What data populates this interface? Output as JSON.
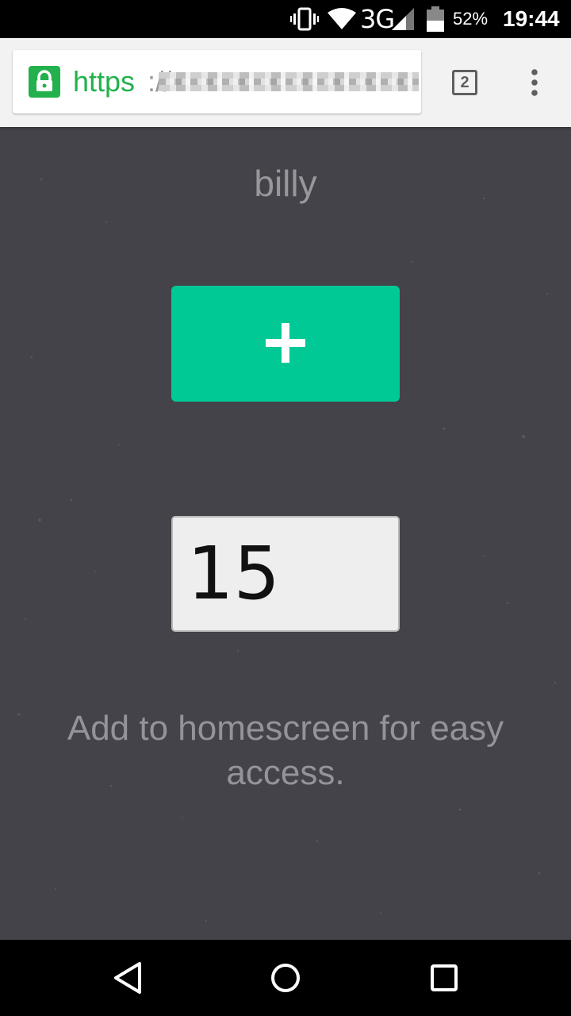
{
  "status_bar": {
    "network_type": "3G",
    "battery_percent": "52%",
    "time": "19:44",
    "icons": [
      "vibrate-icon",
      "wifi-icon",
      "cell-signal-icon",
      "battery-icon"
    ]
  },
  "browser": {
    "url_scheme": "https",
    "url_separator": "://",
    "tab_count": "2",
    "icons": [
      "lock-icon",
      "menu-icon"
    ]
  },
  "page": {
    "user_name": "billy",
    "add_button_icon": "plus-icon",
    "count_value": "15",
    "hint": "Add to homescreen for easy access."
  },
  "nav_bar": {
    "icons": [
      "back-icon",
      "home-icon",
      "recents-icon"
    ]
  },
  "colors": {
    "background": "#44434a",
    "accent": "#00c996",
    "secure_green": "#23b14d"
  }
}
